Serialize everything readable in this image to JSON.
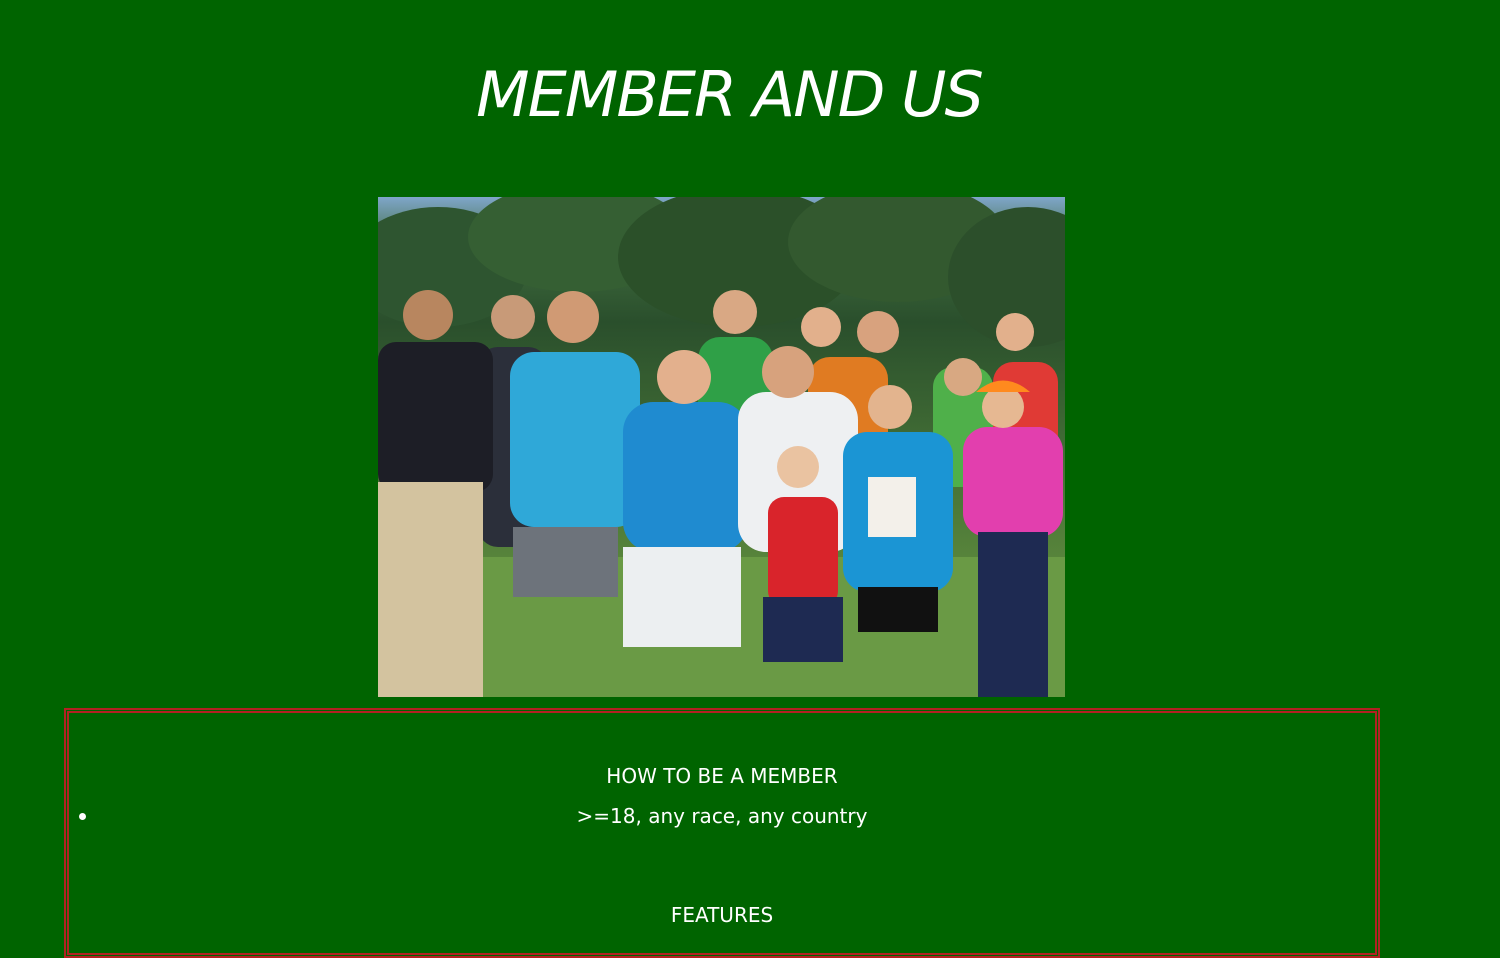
{
  "page": {
    "title": "MEMBER AND US"
  },
  "photo": {
    "description_icon": "group-photo-image"
  },
  "membership": {
    "heading": "HOW TO BE A MEMBER",
    "requirements": [
      ">=18, any race, any country"
    ]
  },
  "features": {
    "heading": "FEATURES"
  },
  "colors": {
    "background": "#006400",
    "box_border": "#b22222",
    "text": "#ffffff"
  }
}
